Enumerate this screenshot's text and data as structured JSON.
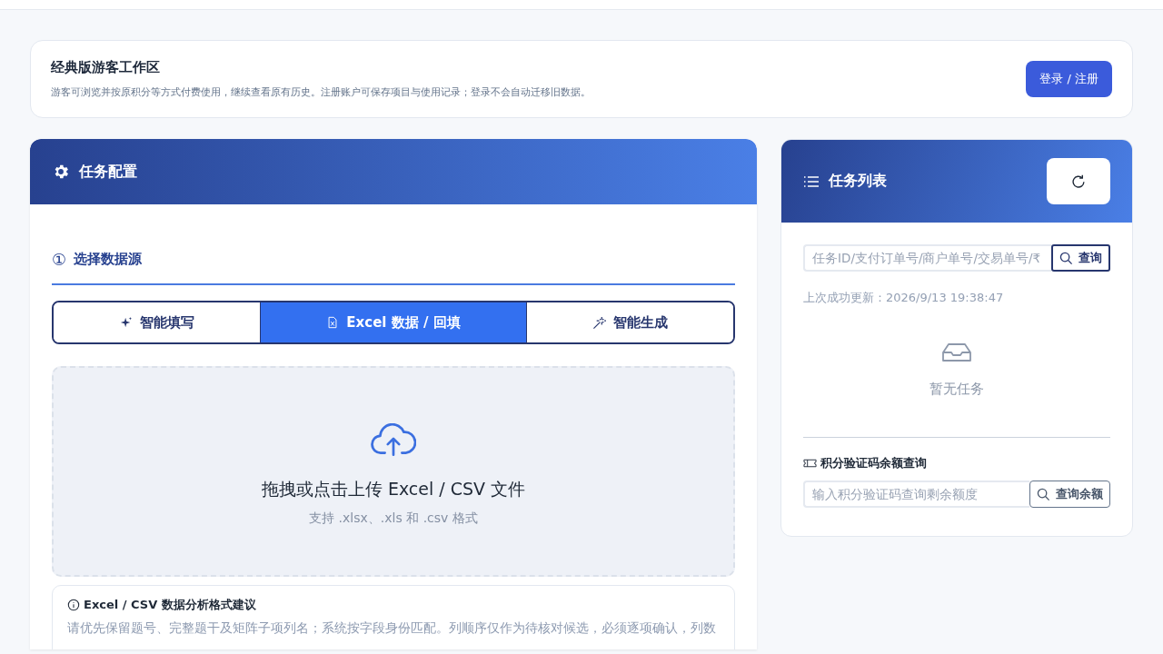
{
  "guest_banner": {
    "title": "经典版游客工作区",
    "description": "游客可浏览并按原积分等方式付费使用，继续查看原有历史。注册账户可保存项目与使用记录；登录不会自动迁移旧数据。",
    "login_button": "登录 / 注册"
  },
  "task_config": {
    "title": "任务配置",
    "step": {
      "number": "①",
      "title": "选择数据源"
    },
    "source_tabs": [
      {
        "label": "智能填写",
        "kind": "sparkle",
        "selected": false
      },
      {
        "label": "Excel 数据 / 回填",
        "kind": "file",
        "selected": true
      },
      {
        "label": "智能生成",
        "kind": "wand",
        "selected": false
      }
    ],
    "upload": {
      "title": "拖拽或点击上传 Excel / CSV 文件",
      "hint": "支持 .xlsx、.xls 和 .csv 格式"
    },
    "format_tip": {
      "title": "Excel / CSV 数据分析格式建议",
      "text": "请优先保留题号、完整题干及矩阵子项列名；系统按字段身份匹配。列顺序仅作为待核对候选，必须逐项确认，列数"
    }
  },
  "task_list": {
    "title": "任务列表",
    "search": {
      "placeholder": "任务ID/支付订单号/商户单号/交易单号/₹",
      "button": "查询"
    },
    "last_update": "上次成功更新：2026/9/13 19:38:47",
    "empty": "暂无任务",
    "balance": {
      "title": "积分验证码余额查询",
      "placeholder": "输入积分验证码查询剩余额度",
      "button": "查询余额"
    }
  }
}
